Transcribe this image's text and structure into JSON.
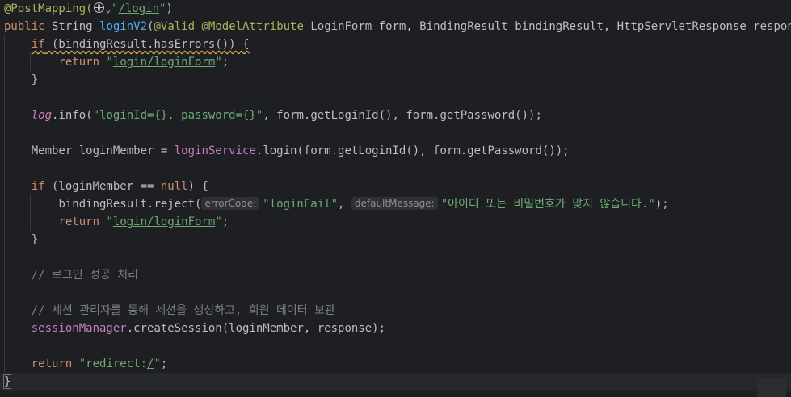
{
  "editor": {
    "l1": {
      "annot": "@PostMapping(",
      "q1": "\"",
      "path": "/login",
      "q2": "\"",
      "end": ")"
    },
    "l2": {
      "kw_public": "public",
      "type": " String ",
      "method": "loginV2",
      "p1": "(",
      "valid": "@Valid",
      "sp1": " ",
      "ma": "@ModelAttribute",
      "rest": " LoginForm form, BindingResult bindingResult, HttpServletResponse response) ",
      "brace": "{"
    },
    "l3": {
      "indent": "    ",
      "kw_if": "if",
      "rest": " (bindingResult.hasErrors()) {"
    },
    "l4": {
      "indent": "        ",
      "kw_return": "return",
      "sp": " ",
      "q1": "\"",
      "path": "login/loginForm",
      "q2": "\"",
      "end": ";"
    },
    "l5": {
      "text": "    }"
    },
    "l7": {
      "indent": "    ",
      "log": "log",
      "rest": ".info(",
      "str": "\"loginId={}, password={}\"",
      "rest2": ", form.getLoginId(), form.getPassword());"
    },
    "l9": {
      "indent": "    ",
      "a": "Member loginMember = ",
      "svc": "loginService",
      "b": ".login(form.getLoginId(), form.getPassword());"
    },
    "l11": {
      "indent": "    ",
      "kw_if": "if",
      "a": " (loginMember == ",
      "kw_null": "null",
      "b": ") {"
    },
    "l12": {
      "indent": "        ",
      "a": "bindingResult.reject(",
      "hint1": "errorCode:",
      "str1": "\"loginFail\"",
      "c": ", ",
      "hint2": "defaultMessage:",
      "str2": "\"아이디 또는 비밀번호가 맞지 않습니다.\"",
      "end": ");"
    },
    "l13": {
      "indent": "        ",
      "kw_return": "return",
      "sp": " ",
      "q1": "\"",
      "path": "login/loginForm",
      "q2": "\"",
      "end": ";"
    },
    "l14": {
      "text": "    }"
    },
    "l16": {
      "indent": "    ",
      "comment": "// 로그인 성공 처리"
    },
    "l18": {
      "indent": "    ",
      "comment": "// 세션 관리자를 통해 세션을 생성하고, 회원 데이터 보관"
    },
    "l19": {
      "indent": "    ",
      "mgr": "sessionManager",
      "rest": ".createSession(loginMember, response);"
    },
    "l21": {
      "indent": "    ",
      "kw_return": "return",
      "sp": " ",
      "q1": "\"redirect:",
      "path": "/",
      "q2": "\"",
      "end": ";"
    },
    "l22": {
      "brace": "}"
    }
  }
}
